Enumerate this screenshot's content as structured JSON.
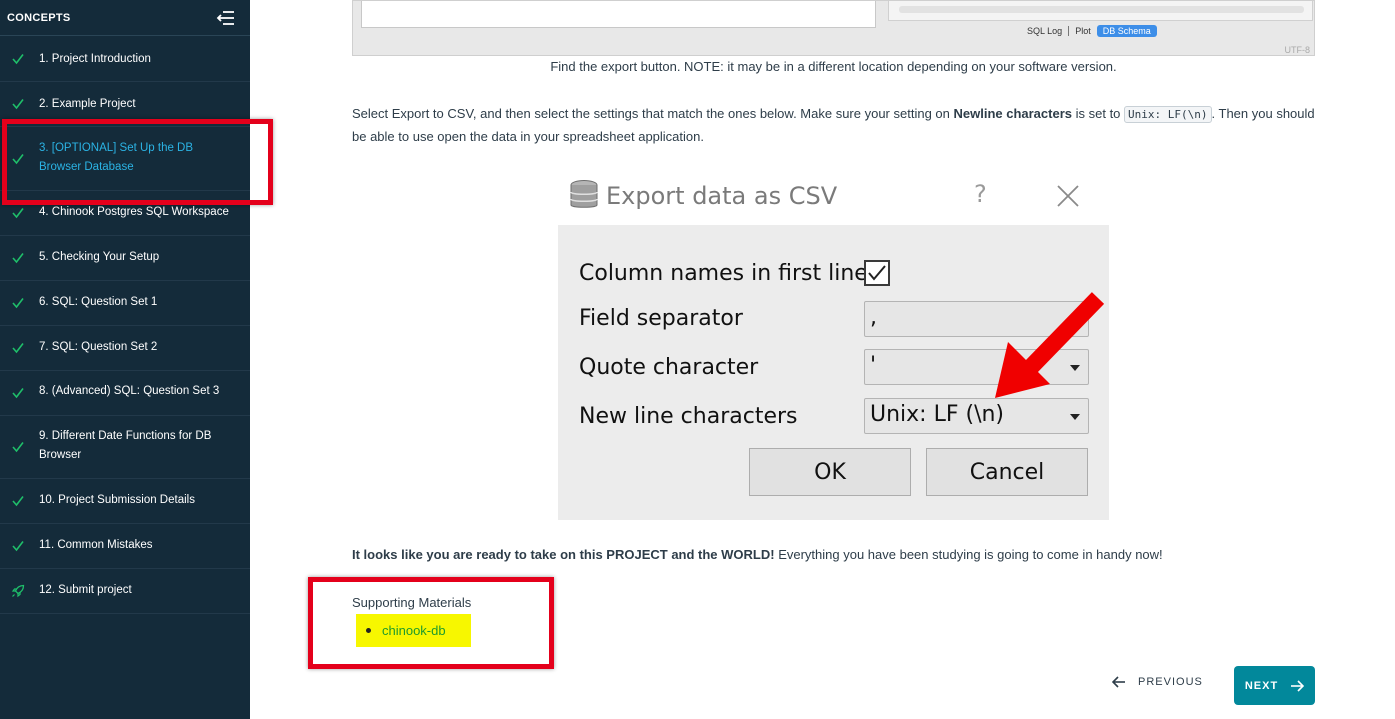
{
  "sidebar": {
    "title": "CONCEPTS",
    "items": [
      {
        "label": "1. Project Introduction",
        "status": "complete"
      },
      {
        "label": "2. Example Project",
        "status": "complete"
      },
      {
        "label": "3. [OPTIONAL] Set Up the DB Browser Database",
        "status": "complete",
        "active": true
      },
      {
        "label": "4. Chinook Postgres SQL Workspace",
        "status": "complete"
      },
      {
        "label": "5. Checking Your Setup",
        "status": "complete"
      },
      {
        "label": "6. SQL: Question Set 1",
        "status": "complete"
      },
      {
        "label": "7. SQL: Question Set 2",
        "status": "complete"
      },
      {
        "label": "8. (Advanced) SQL: Question Set 3",
        "status": "complete"
      },
      {
        "label": "9. Different Date Functions for DB Browser",
        "status": "complete"
      },
      {
        "label": "10. Project Submission Details",
        "status": "complete"
      },
      {
        "label": "11. Common Mistakes",
        "status": "complete"
      },
      {
        "label": "12. Submit project",
        "status": "rocket"
      }
    ]
  },
  "screenshot_top": {
    "tabs": [
      "SQL Log",
      "Plot",
      "DB Schema"
    ],
    "selected_tab": "DB Schema",
    "encoding": "UTF-8"
  },
  "content": {
    "caption": "Find the export button. NOTE: it may be in a different location depending on your software version.",
    "para_part1": "Select Export to CSV, and then select the settings that match the ones below. Make sure your setting on ",
    "para_bold": "Newline characters",
    "para_part2": " is set to ",
    "para_code": "Unix: LF(\\n)",
    "para_part3": ". Then you should be able to use open the data in your spreadsheet application.",
    "ready_bold": "It looks like you are ready to take on this PROJECT and the WORLD!",
    "ready_rest": " Everything you have been studying is going to come in handy now!",
    "supporting_title": "Supporting Materials",
    "supporting_link": "chinook-db"
  },
  "dialog": {
    "title": "Export data as CSV",
    "help": "?",
    "column_names_label": "Column names in first line",
    "column_names_checked": true,
    "field_separator_label": "Field separator",
    "field_separator_value": ",",
    "quote_character_label": "Quote character",
    "quote_character_value": "'",
    "newline_label": "New line characters",
    "newline_value": "Unix: LF (\\n)",
    "ok_label": "OK",
    "cancel_label": "Cancel"
  },
  "nav": {
    "previous_label": "PREVIOUS",
    "next_label": "NEXT"
  },
  "colors": {
    "sidebar_bg": "#142b3a",
    "active_text": "#2bb3e4",
    "check_green": "#1fbf6a",
    "annotation_red": "#e4001b",
    "next_button": "#02889b",
    "highlight_yellow": "#f7f700"
  }
}
